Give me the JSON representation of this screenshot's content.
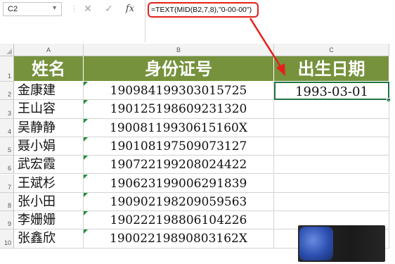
{
  "name_box": "C2",
  "formula_bar": {
    "cancel_icon": "close-icon",
    "enter_icon": "check-icon",
    "fx_label": "fx",
    "formula": "=TEXT(MID(B2,7,8),\"0-00-00\")"
  },
  "columns": [
    "A",
    "B",
    "C"
  ],
  "row_numbers": [
    "1",
    "2",
    "3",
    "4",
    "5",
    "6",
    "7",
    "8",
    "9",
    "10"
  ],
  "header": {
    "name": "姓名",
    "id": "身份证号",
    "birth": "出生日期"
  },
  "rows": [
    {
      "name": "金康建",
      "id": "190984199303015725",
      "birth": "1993-03-01"
    },
    {
      "name": "王山容",
      "id": "190125198609231320",
      "birth": ""
    },
    {
      "name": "吴静静",
      "id": "19008119930615160X",
      "birth": ""
    },
    {
      "name": "聂小娟",
      "id": "190108197509073127",
      "birth": ""
    },
    {
      "name": "武宏霞",
      "id": "190722199208024422",
      "birth": ""
    },
    {
      "name": "王斌杉",
      "id": "190623199006291839",
      "birth": ""
    },
    {
      "name": "张小田",
      "id": "190902198209059563",
      "birth": ""
    },
    {
      "name": "李姗姗",
      "id": "190222198806104226",
      "birth": ""
    },
    {
      "name": "张鑫欣",
      "id": "19002219890803162X",
      "birth": ""
    }
  ],
  "colors": {
    "header_fill": "#76923c",
    "annotation_red": "#e3211c",
    "selection_green": "#217346"
  }
}
